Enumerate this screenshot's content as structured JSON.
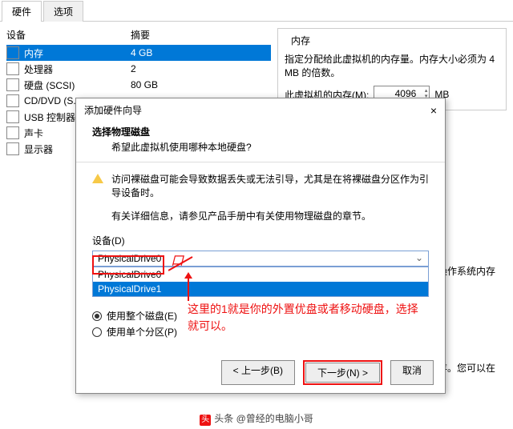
{
  "tabs": {
    "hardware": "硬件",
    "options": "选项"
  },
  "columns": {
    "device": "设备",
    "summary": "摘要"
  },
  "devices": [
    {
      "name": "内存",
      "value": "4 GB",
      "icon": "memory-icon",
      "selected": true
    },
    {
      "name": "处理器",
      "value": "2",
      "icon": "cpu-icon"
    },
    {
      "name": "硬盘 (SCSI)",
      "value": "80 GB",
      "icon": "disk-icon"
    },
    {
      "name": "CD/DVD (S...",
      "value": "",
      "icon": "cd-icon"
    },
    {
      "name": "USB 控制器",
      "value": "",
      "icon": "usb-icon"
    },
    {
      "name": "声卡",
      "value": "",
      "icon": "sound-icon"
    },
    {
      "name": "显示器",
      "value": "",
      "icon": "display-icon"
    }
  ],
  "memory": {
    "group_title": "内存",
    "desc": "指定分配给此虚拟机的内存量。内存大小必须为 4 MB 的倍数。",
    "field_label": "此虚拟机的内存(M):",
    "value": "4096",
    "unit": "MB"
  },
  "wizard": {
    "window_title": "添加硬件向导",
    "header_title": "选择物理磁盘",
    "header_sub": "希望此虚拟机使用哪种本地硬盘?",
    "warn": "访问裸磁盘可能会导致数据丢失或无法引导，尤其是在将裸磁盘分区作为引导设备时。",
    "info": "有关详细信息，请参见产品手册中有关使用物理磁盘的章节。",
    "device_label": "设备(D)",
    "selected": "PhysicalDrive0",
    "options": [
      "PhysicalDrive0",
      "PhysicalDrive1"
    ],
    "radios": {
      "whole": "使用整个磁盘(E)",
      "single": "使用单个分区(P)"
    },
    "btn_prev": "< 上一步(B)",
    "btn_next": "下一步(N) >",
    "btn_cancel": "取消"
  },
  "annotations": {
    "slash_label": "口",
    "text": "这里的1就是你的外置优盘或者移动硬盘，选择就可以。"
  },
  "fragments": {
    "f1": "操作系统内存",
    "f2": "存。您可以在"
  },
  "footer": {
    "prefix": "头条",
    "author": "@曾经的电脑小哥"
  }
}
